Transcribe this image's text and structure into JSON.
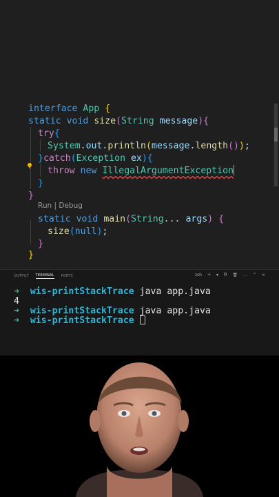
{
  "editor": {
    "code_lines": [
      "interface App {",
      "static void size(String message){",
      "try{",
      "System.out.println(message.length());",
      "}catch(Exception ex){",
      "throw new IllegalArgumentException",
      "}",
      "}",
      "static void main(String... args) {",
      "size(null);",
      "}",
      "}"
    ],
    "codelens": {
      "run": "Run",
      "separator": " | ",
      "debug": "Debug"
    },
    "tokens": {
      "l1": {
        "kw": "interface",
        "name": "App",
        "brace": "{"
      },
      "l2": {
        "kw1": "static",
        "kw2": "void",
        "fn": "size",
        "open": "(",
        "type": "String",
        "param": "message",
        "close": ")",
        "brace": "{"
      },
      "l3": {
        "kw": "try",
        "brace": "{"
      },
      "l4": {
        "cls": "System",
        "d1": ".",
        "fld": "out",
        "d2": ".",
        "fn": "println",
        "p1": "(",
        "var": "message",
        "d3": ".",
        "fn2": "length",
        "p2": "()",
        "p3": ")",
        "semi": ";"
      },
      "l5": {
        "brace": "}",
        "kw": "catch",
        "open": "(",
        "type": "Exception",
        "var": "ex",
        "close": ")",
        "brace2": "{"
      },
      "l6": {
        "kw1": "throw",
        "kw2": "new",
        "type": "IllegalArgumentException"
      },
      "l7": {
        "brace": "}"
      },
      "l8": {
        "brace": "}"
      },
      "l9": {
        "kw1": "static",
        "kw2": "void",
        "fn": "main",
        "open": "(",
        "type": "String",
        "dots": "...",
        "var": "args",
        "close": ")",
        "brace": "{"
      },
      "l10": {
        "fn": "size",
        "open": "(",
        "kw": "null",
        "close": ")",
        "semi": ";"
      },
      "l11": {
        "brace": "}"
      },
      "l12": {
        "brace": "}"
      }
    }
  },
  "panel": {
    "tabs": [
      "OUTPUT",
      "TERMINAL",
      "PORTS"
    ],
    "active_tab": "TERMINAL",
    "shell_label": "zsh",
    "actions": [
      "+",
      "▾",
      "⧉",
      "🗑",
      "…",
      "^",
      "×"
    ]
  },
  "terminal": {
    "prompt_arrow": "➜",
    "lines": [
      {
        "cwd": "wis-printStackTrace",
        "cmd": "java app.java"
      },
      {
        "output": "4"
      },
      {
        "cwd": "wis-printStackTrace",
        "cmd": "java app.java"
      },
      {
        "cwd": "wis-printStackTrace",
        "cmd": ""
      }
    ]
  },
  "colors": {
    "editor_bg": "#1f1f1f",
    "panel_bg": "#181818",
    "keyword": "#569cd6",
    "type": "#4ec9b0",
    "function": "#dcdcaa",
    "variable": "#9cdcfe",
    "prompt_arrow": "#23d18b",
    "cwd": "#29b8db"
  }
}
